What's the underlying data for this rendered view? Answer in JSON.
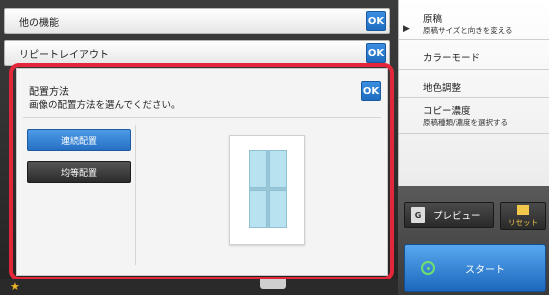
{
  "bars": {
    "other_functions": "他の機能",
    "repeat_layout": "リピートレイアウト",
    "ok_label": "OK"
  },
  "main": {
    "title": "配置方法",
    "description": "画像の配置方法を選んでください。",
    "options": [
      {
        "label": "連続配置",
        "selected": true
      },
      {
        "label": "均等配置",
        "selected": false
      }
    ]
  },
  "right_menu": [
    {
      "name": "原稿",
      "sub": "原稿サイズと向きを変える"
    },
    {
      "name": "カラーモード",
      "sub": ""
    },
    {
      "name": "地色調整",
      "sub": ""
    },
    {
      "name": "コピー濃度",
      "sub": "原稿種類/濃度を選択する"
    }
  ],
  "actions": {
    "preview": "プレビュー",
    "reset": "リセット",
    "start": "スタート"
  },
  "colors": {
    "accent_blue": "#2670c4",
    "highlight_red": "#e3263a",
    "start_green": "#6fe06f"
  },
  "icons": {
    "play": "play-icon",
    "preview": "preview-icon",
    "reset": "reset-icon",
    "start": "start-icon",
    "star": "star-icon"
  }
}
